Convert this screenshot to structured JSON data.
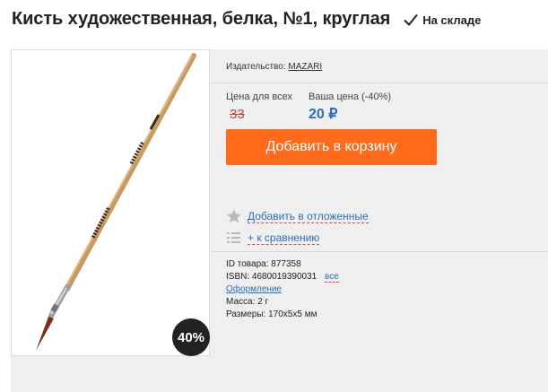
{
  "product": {
    "title": "Кисть художественная, белка, №1, круглая",
    "stock_status": "На складе",
    "discount_badge": "40%"
  },
  "publisher": {
    "label": "Издательство:",
    "name": "MAZARI"
  },
  "price": {
    "label_all": "Цена для всех",
    "label_yours": "Ваша цена (-40%)",
    "old_price": "33",
    "new_price": "20 ₽"
  },
  "actions": {
    "add_to_cart": "Добавить в корзину",
    "defer": "Добавить в отложенные",
    "compare": "+ к сравнению"
  },
  "details": {
    "id_label": "ID товара:",
    "id_value": "877358",
    "isbn_label": "ISBN:",
    "isbn_value": "4680019390031",
    "isbn_all": "все",
    "design": "Оформление",
    "weight_label": "Масса:",
    "weight_value": "2 г",
    "size_label": "Размеры:",
    "size_value": "170x5x5 мм"
  },
  "colors": {
    "accent_orange": "#ff6b1a",
    "link_blue": "#2a6fb7",
    "old_price_red": "#c9463d",
    "badge_dark": "#222222"
  }
}
